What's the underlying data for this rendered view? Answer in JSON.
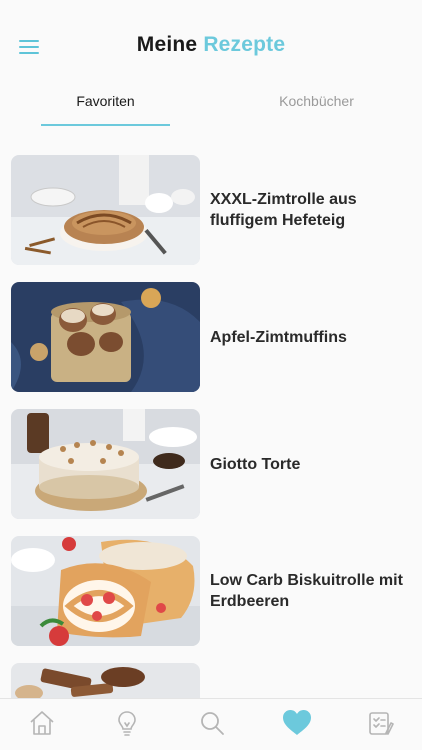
{
  "header": {
    "title_part1": "Meine",
    "title_part2": "Rezepte"
  },
  "tabs": [
    {
      "label": "Favoriten",
      "active": true
    },
    {
      "label": "Kochbücher",
      "active": false
    }
  ],
  "recipes": [
    {
      "title": "XXXL-Zimtrolle aus fluffigem Hefeteig",
      "image": "cinnamon-roll-photo"
    },
    {
      "title": "Apfel-Zimtmuffins",
      "image": "apple-cinnamon-muffins-photo"
    },
    {
      "title": "Giotto Torte",
      "image": "giotto-cake-photo"
    },
    {
      "title": "Low Carb Biskuitrolle mit Erdbeeren",
      "image": "strawberry-swiss-roll-photo"
    },
    {
      "title": "",
      "image": "chocolate-dessert-photo"
    }
  ],
  "tabbar": {
    "items": [
      {
        "icon": "home-icon"
      },
      {
        "icon": "lightbulb-icon"
      },
      {
        "icon": "search-icon"
      },
      {
        "icon": "heart-icon",
        "active": true
      },
      {
        "icon": "shopping-list-icon"
      }
    ]
  },
  "colors": {
    "accent": "#6cc9dc",
    "text": "#1a1a1a",
    "inactive": "#9a9a9a",
    "icon_inactive": "#b5b5b5"
  }
}
